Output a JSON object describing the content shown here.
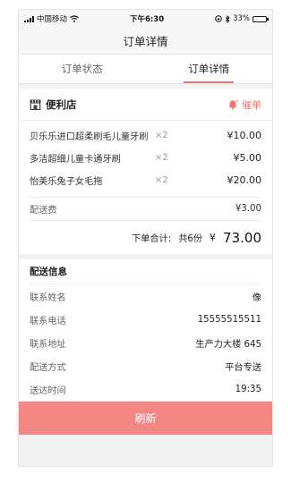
{
  "status_bar": {
    "carrier": "中国移动",
    "time": "下午6:30",
    "battery": "33%",
    "battery_level": 0.33
  },
  "nav": {
    "title": "订单详情"
  },
  "tabs": [
    {
      "label": "订单状态"
    },
    {
      "label": "订单详情"
    }
  ],
  "store": {
    "name": "便利店",
    "urge_label": "催单"
  },
  "items": [
    {
      "name": "贝乐乐进口超柔刷毛儿童牙刷",
      "qty": "×2",
      "price": "¥10.00"
    },
    {
      "name": "多洁超细儿童卡通牙刷",
      "qty": "×2",
      "price": "¥5.00"
    },
    {
      "name": "怡美乐兔子女毛拖",
      "qty": "×2",
      "price": "¥20.00"
    }
  ],
  "fee": {
    "label": "配送费",
    "value": "¥3.00"
  },
  "total": {
    "label": "下单合计:",
    "count": "共6份",
    "currency": "¥",
    "amount": "73.00"
  },
  "delivery": {
    "title": "配送信息",
    "rows": [
      {
        "label": "联系姓名",
        "value": "像"
      },
      {
        "label": "联系电话",
        "value": "15555515511"
      },
      {
        "label": "联系地址",
        "value": "生产力大楼 645"
      },
      {
        "label": "配送方式",
        "value": "平台专送"
      },
      {
        "label": "送达时间",
        "value": "19:35"
      }
    ]
  },
  "refresh_label": "刷新",
  "colors": {
    "accent": "#f3736f",
    "button": "#f48784"
  }
}
